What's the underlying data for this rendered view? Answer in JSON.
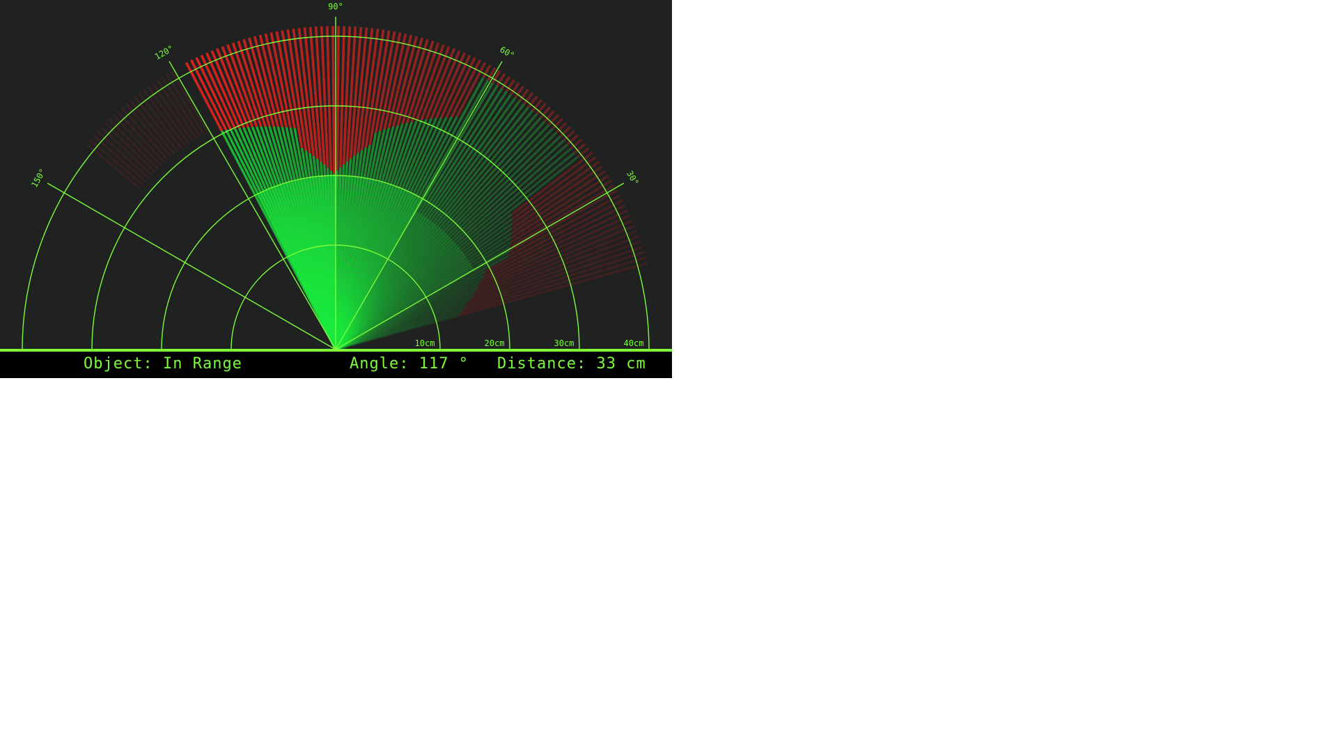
{
  "status": {
    "object_label": "Object:",
    "object_value": "In Range",
    "angle_label": "Angle:",
    "angle_value": "117",
    "angle_unit": "°",
    "distance_label": "Distance:",
    "distance_value": "33",
    "distance_unit": "cm"
  },
  "angle_labels": [
    {
      "deg": 30,
      "text": "30°"
    },
    {
      "deg": 60,
      "text": "60°"
    },
    {
      "deg": 90,
      "text": "90°"
    },
    {
      "deg": 120,
      "text": "120°"
    },
    {
      "deg": 150,
      "text": "150°"
    }
  ],
  "range_labels": [
    {
      "cm": 10,
      "text": "10cm"
    },
    {
      "cm": 20,
      "text": "20cm"
    },
    {
      "cm": 30,
      "text": "30cm"
    },
    {
      "cm": 40,
      "text": "40cm"
    }
  ],
  "colors": {
    "grid": "#7cfc3a",
    "sweep": "#19e83c",
    "object": "#e0241e",
    "background": "#202121",
    "status_bg": "#000000"
  }
}
